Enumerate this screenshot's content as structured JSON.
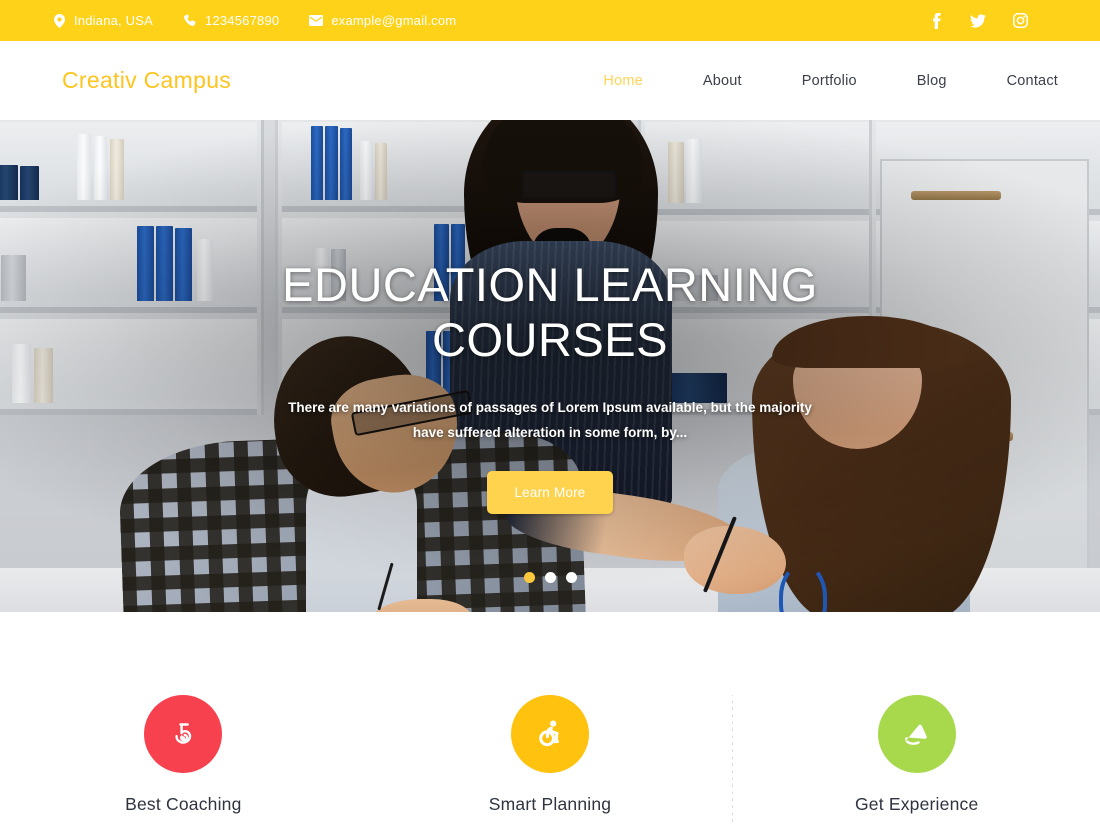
{
  "topbar": {
    "background": "#FFD21A",
    "contacts": [
      {
        "icon": "location-pin-icon",
        "text": "Indiana, USA"
      },
      {
        "icon": "phone-icon",
        "text": "1234567890"
      },
      {
        "icon": "envelope-icon",
        "text": "example@gmail.com"
      }
    ],
    "social": [
      {
        "icon": "facebook-icon",
        "name": "Facebook"
      },
      {
        "icon": "twitter-icon",
        "name": "Twitter"
      },
      {
        "icon": "instagram-icon",
        "name": "Instagram"
      }
    ]
  },
  "header": {
    "logo": "Creativ Campus",
    "logo_color": "#FFC41F",
    "nav": [
      {
        "label": "Home",
        "active": true
      },
      {
        "label": "About",
        "active": false
      },
      {
        "label": "Portfolio",
        "active": false
      },
      {
        "label": "Blog",
        "active": false
      },
      {
        "label": "Contact",
        "active": false
      }
    ]
  },
  "hero": {
    "title": "EDUCATION LEARNING COURSES",
    "subtitle": "There are many variations of passages of Lorem Ipsum available, but the majority have suffered alteration in some form, by...",
    "button_label": "Learn More",
    "button_color": "#FFD34E",
    "slides": [
      {
        "index": 1,
        "active": true
      },
      {
        "index": 2,
        "active": false
      },
      {
        "index": 3,
        "active": false
      }
    ],
    "active_dot_color": "#FFC83D"
  },
  "features": [
    {
      "icon": "spiral-badge-icon",
      "label": "Best Coaching",
      "color": "#F7414F"
    },
    {
      "icon": "accessible-wheelchair-icon",
      "label": "Smart Planning",
      "color": "#FFC20E"
    },
    {
      "icon": "hang-glider-icon",
      "label": "Get Experience",
      "color": "#A4D champ"
    }
  ],
  "feature_colors": {
    "best_coaching": "#F7414F",
    "smart_planning": "#FFC20E",
    "get_experience": "#A3D champ"
  }
}
